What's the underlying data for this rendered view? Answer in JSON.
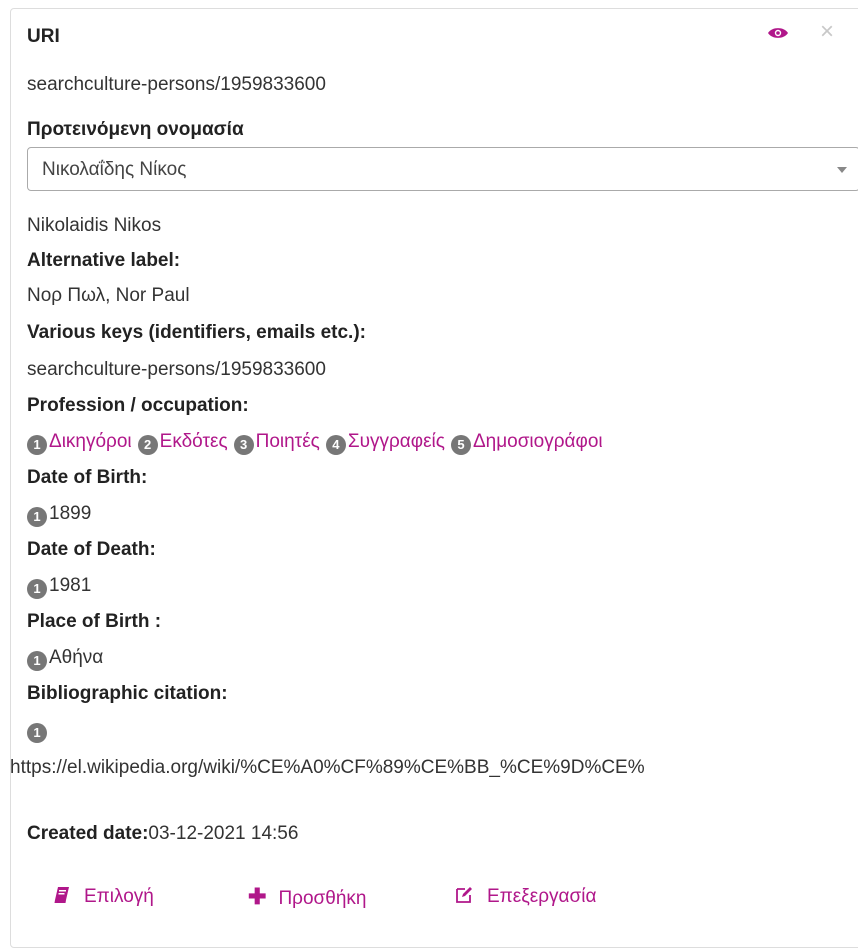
{
  "header": {
    "title": "URI",
    "eye_icon": "eye-icon",
    "close_icon": "close-icon"
  },
  "uri_value": "searchculture-persons/1959833600",
  "preferred": {
    "label": "Προτεινόμενη ονομασία",
    "selected": "Νικολαΐδης Νίκος"
  },
  "transliteration": "Nikolaidis Nikos",
  "alt_label": {
    "label": "Alternative label:",
    "value": "Νορ Πωλ, Nor Paul"
  },
  "keys": {
    "label": "Various keys (identifiers, emails etc.):",
    "value": "searchculture-persons/1959833600"
  },
  "profession": {
    "label": "Profession / occupation:",
    "items": [
      {
        "n": "1",
        "name": "Δικηγόροι"
      },
      {
        "n": "2",
        "name": "Εκδότες"
      },
      {
        "n": "3",
        "name": "Ποιητές"
      },
      {
        "n": "4",
        "name": "Συγγραφείς"
      },
      {
        "n": "5",
        "name": "Δημοσιογράφοι"
      }
    ]
  },
  "birth": {
    "label": "Date of Birth:",
    "n": "1",
    "value": "1899"
  },
  "death": {
    "label": "Date of Death:",
    "n": "1",
    "value": "1981"
  },
  "place": {
    "label": "Place of Birth :",
    "n": "1",
    "value": "Αθήνα"
  },
  "biblio": {
    "label": "Bibliographic citation:",
    "n": "1",
    "value": "https://el.wikipedia.org/wiki/%CE%A0%CF%89%CE%BB_%CE%9D%CE%"
  },
  "created": {
    "label": "Created date:",
    "value": "03-12-2021 14:56"
  },
  "actions": {
    "select": "Επιλογή",
    "add": "Προσθήκη",
    "edit": "Επεξεργασία"
  },
  "colors": {
    "accent": "#b0178a",
    "badge": "#777777",
    "border": "#dddddd"
  }
}
